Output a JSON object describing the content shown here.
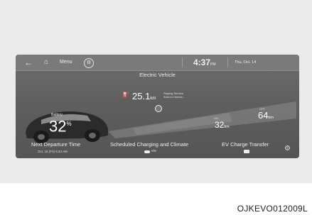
{
  "header": {
    "back_icon": "back-arrow-icon",
    "home_icon": "home-icon",
    "menu_label": "Menu",
    "settings_icon": "gear-icon",
    "time": "4:37",
    "ampm": "PM",
    "date": "Thu, Oct. 14"
  },
  "title": "Electric Vehicle",
  "battery": {
    "label": "Battery",
    "value": "32",
    "unit": "%"
  },
  "range_service": {
    "value": "25.1",
    "unit": "km",
    "note_line1": "Staying Service",
    "note_line2": "Area to Homes..."
  },
  "range_on": {
    "label": "ON",
    "value": "32",
    "unit": "km"
  },
  "range_off": {
    "label": "OFF",
    "value": "64",
    "unit": "km"
  },
  "bottom": {
    "next_departure": "Next Departure Time",
    "next_departure_sub": "Oct. 15 (Fri) 6:44 AM",
    "scheduled": "Scheduled Charging and Climate",
    "scheduled_state": "ON",
    "transfer": "EV Charge Transfer",
    "settings_icon": "gear-icon"
  },
  "caption": "OJKEVO012009L"
}
